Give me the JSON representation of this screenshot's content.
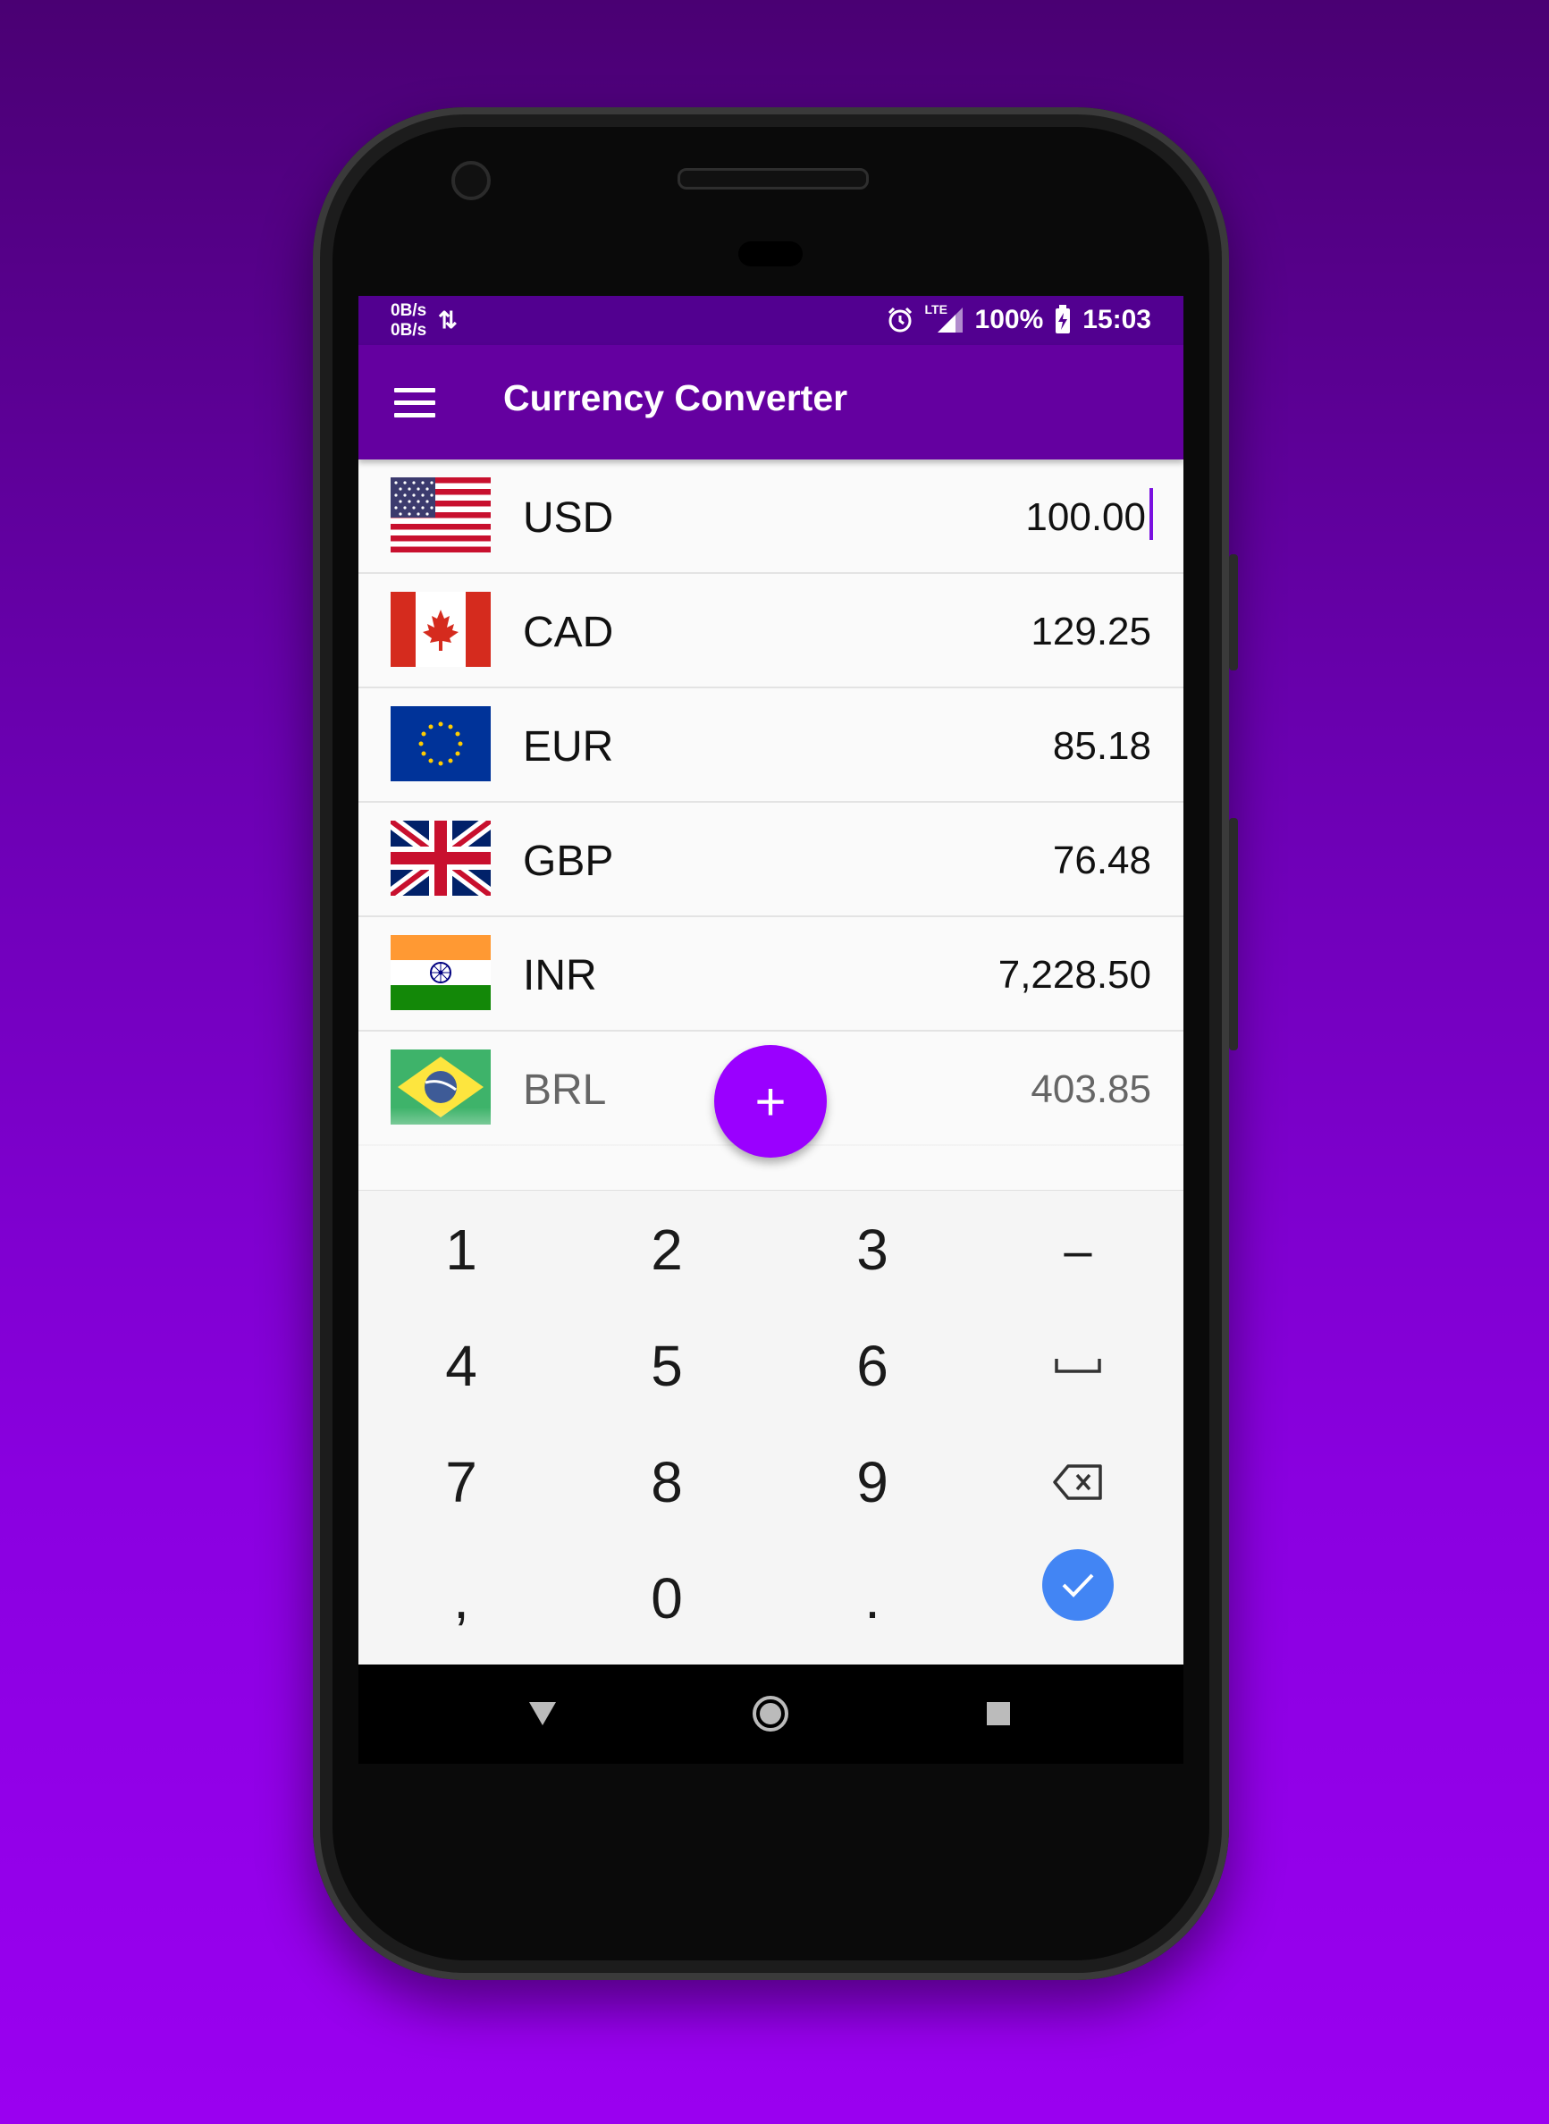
{
  "status_bar": {
    "net_up": "0B/s",
    "net_down": "0B/s",
    "net_icon": "data-transfer-icon",
    "alarm_icon": "alarm-icon",
    "signal_icon": "lte-signal-icon",
    "signal_label": "LTE",
    "battery_percent": "100%",
    "battery_icon": "battery-charging-icon",
    "time": "15:03"
  },
  "app_bar": {
    "menu_icon": "hamburger-menu-icon",
    "title": "Currency Converter"
  },
  "currencies": [
    {
      "code": "USD",
      "amount": "100.00",
      "flag": "us-flag",
      "active": true
    },
    {
      "code": "CAD",
      "amount": "129.25",
      "flag": "canada-flag"
    },
    {
      "code": "EUR",
      "amount": "85.18",
      "flag": "eu-flag"
    },
    {
      "code": "GBP",
      "amount": "76.48",
      "flag": "uk-flag"
    },
    {
      "code": "INR",
      "amount": "7,228.50",
      "flag": "india-flag"
    },
    {
      "code": "BRL",
      "amount": "403.85",
      "flag": "brazil-flag"
    }
  ],
  "fab": {
    "label": "+",
    "icon": "add-icon"
  },
  "keypad": {
    "keys": [
      "1",
      "2",
      "3",
      "–",
      "4",
      "5",
      "6",
      "␣",
      "7",
      "8",
      "9",
      "⌫",
      ",",
      "0",
      ".",
      "✓"
    ]
  },
  "nav_bar": {
    "back_icon": "back-triangle-icon",
    "home_icon": "home-circle-icon",
    "recents_icon": "recents-square-icon"
  },
  "colors": {
    "status_bar": "#520090",
    "app_bar": "#6400a0",
    "fab": "#9a00ff",
    "caret": "#7a10e0",
    "done_button": "#4285f4"
  }
}
